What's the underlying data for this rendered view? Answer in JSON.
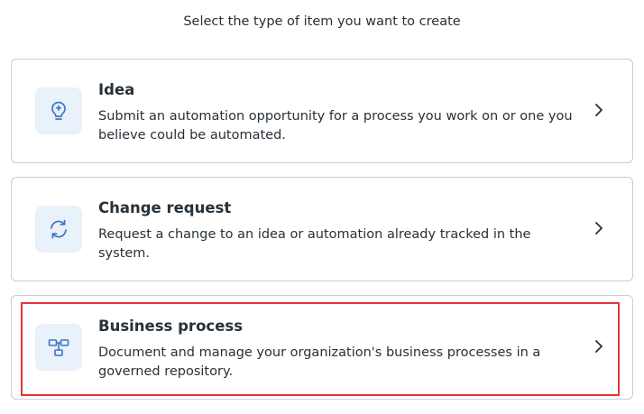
{
  "prompt": "Select the type of item you want to create",
  "items": [
    {
      "title": "Idea",
      "description": "Submit an automation opportunity for a process you work on or one you believe could be automated.",
      "icon": "lightbulb-icon"
    },
    {
      "title": "Change request",
      "description": "Request a change to an idea or automation already tracked in the system.",
      "icon": "refresh-icon"
    },
    {
      "title": "Business process",
      "description": "Document and manage your organization's business processes in a governed repository.",
      "icon": "process-diagram-icon"
    }
  ],
  "colors": {
    "accent": "#3b74c4",
    "icon_bg": "#e9f1fa",
    "highlight": "#e5333b",
    "border": "#c7cdd3"
  }
}
